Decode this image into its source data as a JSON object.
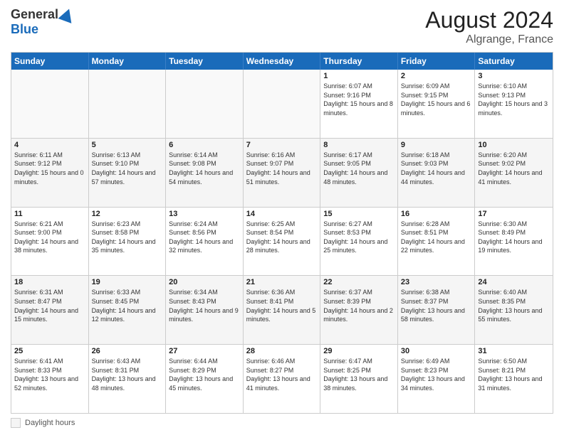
{
  "logo": {
    "general": "General",
    "blue": "Blue"
  },
  "title": "August 2024",
  "subtitle": "Algrange, France",
  "legend": {
    "label": "Daylight hours"
  },
  "header_days": [
    "Sunday",
    "Monday",
    "Tuesday",
    "Wednesday",
    "Thursday",
    "Friday",
    "Saturday"
  ],
  "rows": [
    [
      {
        "day": "",
        "info": "",
        "empty": true
      },
      {
        "day": "",
        "info": "",
        "empty": true
      },
      {
        "day": "",
        "info": "",
        "empty": true
      },
      {
        "day": "",
        "info": "",
        "empty": true
      },
      {
        "day": "1",
        "info": "Sunrise: 6:07 AM\nSunset: 9:16 PM\nDaylight: 15 hours\nand 8 minutes."
      },
      {
        "day": "2",
        "info": "Sunrise: 6:09 AM\nSunset: 9:15 PM\nDaylight: 15 hours\nand 6 minutes."
      },
      {
        "day": "3",
        "info": "Sunrise: 6:10 AM\nSunset: 9:13 PM\nDaylight: 15 hours\nand 3 minutes."
      }
    ],
    [
      {
        "day": "4",
        "info": "Sunrise: 6:11 AM\nSunset: 9:12 PM\nDaylight: 15 hours\nand 0 minutes.",
        "alt": true
      },
      {
        "day": "5",
        "info": "Sunrise: 6:13 AM\nSunset: 9:10 PM\nDaylight: 14 hours\nand 57 minutes.",
        "alt": true
      },
      {
        "day": "6",
        "info": "Sunrise: 6:14 AM\nSunset: 9:08 PM\nDaylight: 14 hours\nand 54 minutes.",
        "alt": true
      },
      {
        "day": "7",
        "info": "Sunrise: 6:16 AM\nSunset: 9:07 PM\nDaylight: 14 hours\nand 51 minutes.",
        "alt": true
      },
      {
        "day": "8",
        "info": "Sunrise: 6:17 AM\nSunset: 9:05 PM\nDaylight: 14 hours\nand 48 minutes.",
        "alt": true
      },
      {
        "day": "9",
        "info": "Sunrise: 6:18 AM\nSunset: 9:03 PM\nDaylight: 14 hours\nand 44 minutes.",
        "alt": true
      },
      {
        "day": "10",
        "info": "Sunrise: 6:20 AM\nSunset: 9:02 PM\nDaylight: 14 hours\nand 41 minutes.",
        "alt": true
      }
    ],
    [
      {
        "day": "11",
        "info": "Sunrise: 6:21 AM\nSunset: 9:00 PM\nDaylight: 14 hours\nand 38 minutes."
      },
      {
        "day": "12",
        "info": "Sunrise: 6:23 AM\nSunset: 8:58 PM\nDaylight: 14 hours\nand 35 minutes."
      },
      {
        "day": "13",
        "info": "Sunrise: 6:24 AM\nSunset: 8:56 PM\nDaylight: 14 hours\nand 32 minutes."
      },
      {
        "day": "14",
        "info": "Sunrise: 6:25 AM\nSunset: 8:54 PM\nDaylight: 14 hours\nand 28 minutes."
      },
      {
        "day": "15",
        "info": "Sunrise: 6:27 AM\nSunset: 8:53 PM\nDaylight: 14 hours\nand 25 minutes."
      },
      {
        "day": "16",
        "info": "Sunrise: 6:28 AM\nSunset: 8:51 PM\nDaylight: 14 hours\nand 22 minutes."
      },
      {
        "day": "17",
        "info": "Sunrise: 6:30 AM\nSunset: 8:49 PM\nDaylight: 14 hours\nand 19 minutes."
      }
    ],
    [
      {
        "day": "18",
        "info": "Sunrise: 6:31 AM\nSunset: 8:47 PM\nDaylight: 14 hours\nand 15 minutes.",
        "alt": true
      },
      {
        "day": "19",
        "info": "Sunrise: 6:33 AM\nSunset: 8:45 PM\nDaylight: 14 hours\nand 12 minutes.",
        "alt": true
      },
      {
        "day": "20",
        "info": "Sunrise: 6:34 AM\nSunset: 8:43 PM\nDaylight: 14 hours\nand 9 minutes.",
        "alt": true
      },
      {
        "day": "21",
        "info": "Sunrise: 6:36 AM\nSunset: 8:41 PM\nDaylight: 14 hours\nand 5 minutes.",
        "alt": true
      },
      {
        "day": "22",
        "info": "Sunrise: 6:37 AM\nSunset: 8:39 PM\nDaylight: 14 hours\nand 2 minutes.",
        "alt": true
      },
      {
        "day": "23",
        "info": "Sunrise: 6:38 AM\nSunset: 8:37 PM\nDaylight: 13 hours\nand 58 minutes.",
        "alt": true
      },
      {
        "day": "24",
        "info": "Sunrise: 6:40 AM\nSunset: 8:35 PM\nDaylight: 13 hours\nand 55 minutes.",
        "alt": true
      }
    ],
    [
      {
        "day": "25",
        "info": "Sunrise: 6:41 AM\nSunset: 8:33 PM\nDaylight: 13 hours\nand 52 minutes."
      },
      {
        "day": "26",
        "info": "Sunrise: 6:43 AM\nSunset: 8:31 PM\nDaylight: 13 hours\nand 48 minutes."
      },
      {
        "day": "27",
        "info": "Sunrise: 6:44 AM\nSunset: 8:29 PM\nDaylight: 13 hours\nand 45 minutes."
      },
      {
        "day": "28",
        "info": "Sunrise: 6:46 AM\nSunset: 8:27 PM\nDaylight: 13 hours\nand 41 minutes."
      },
      {
        "day": "29",
        "info": "Sunrise: 6:47 AM\nSunset: 8:25 PM\nDaylight: 13 hours\nand 38 minutes."
      },
      {
        "day": "30",
        "info": "Sunrise: 6:49 AM\nSunset: 8:23 PM\nDaylight: 13 hours\nand 34 minutes."
      },
      {
        "day": "31",
        "info": "Sunrise: 6:50 AM\nSunset: 8:21 PM\nDaylight: 13 hours\nand 31 minutes."
      }
    ]
  ]
}
